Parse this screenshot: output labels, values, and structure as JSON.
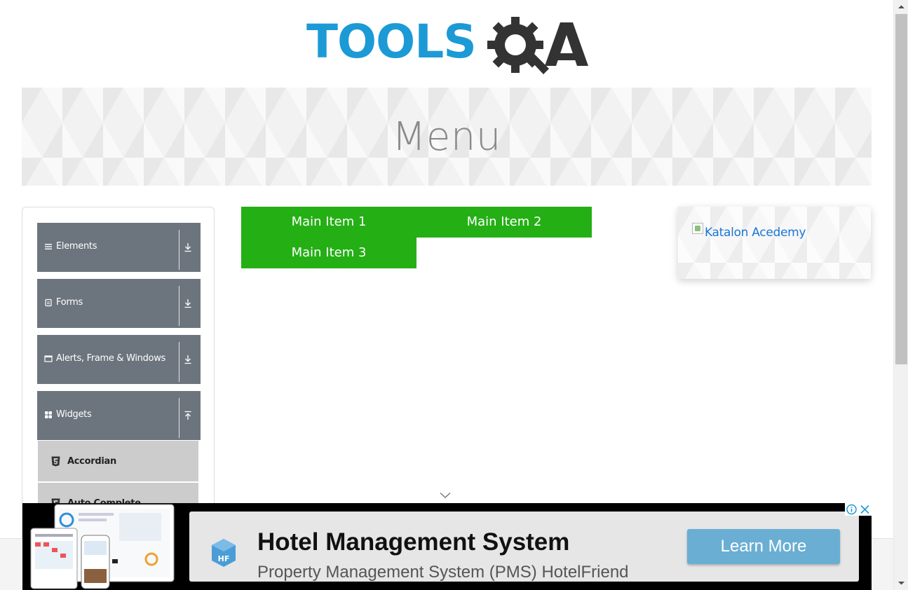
{
  "header": {
    "logo_text": "TOOLSQA",
    "logo_word": "TOOLS"
  },
  "banner": {
    "title": "Menu"
  },
  "sidebar": {
    "groups": [
      {
        "label": "Elements",
        "icon": "hamburger-icon",
        "expanded": false
      },
      {
        "label": "Forms",
        "icon": "form-icon",
        "expanded": false
      },
      {
        "label": "Alerts, Frame & Windows",
        "icon": "window-icon",
        "expanded": false
      },
      {
        "label": "Widgets",
        "icon": "grid-icon",
        "expanded": true
      }
    ],
    "widgets_items": [
      {
        "label": "Accordian",
        "icon": "html5-icon"
      },
      {
        "label": "Auto Complete",
        "icon": "html5-icon"
      }
    ]
  },
  "menu": {
    "items": [
      "Main Item 1",
      "Main Item 2",
      "Main Item 3"
    ],
    "color": "#24af15"
  },
  "right_ad": {
    "alt_text": "Katalon Acedemy"
  },
  "bottom_ad": {
    "title": "Hotel Management System",
    "subtitle": "Property Management System (PMS) HotelFriend",
    "button": "Learn More",
    "logo_letters": "HF"
  },
  "colors": {
    "brand_blue": "#1c9ad6",
    "brand_dark": "#333333",
    "sidebar_group": "#6c757d",
    "sidebar_subitem": "#cccccc",
    "ad_button": "#6aaed3"
  }
}
